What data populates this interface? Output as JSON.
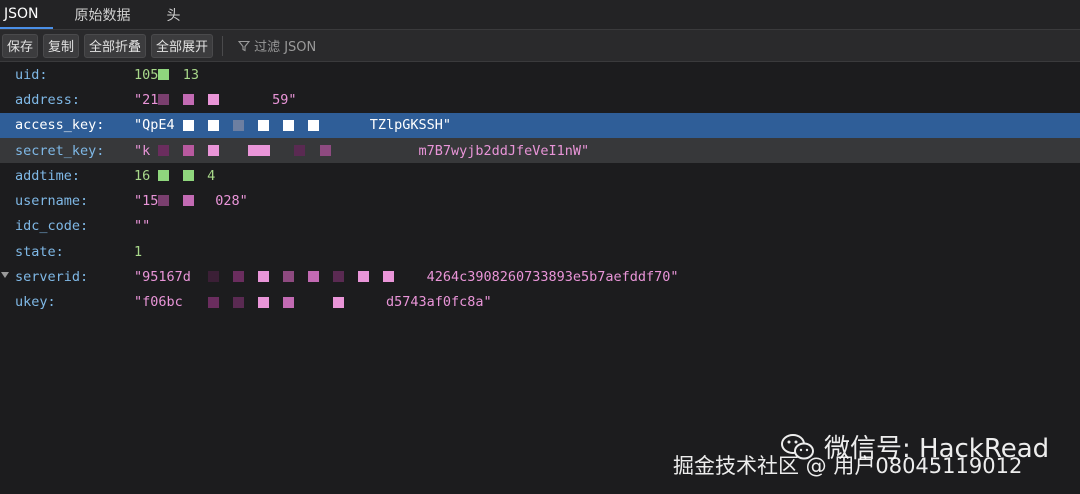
{
  "tabs": [
    {
      "label": "JSON"
    },
    {
      "label": "原始数据"
    },
    {
      "label": "头"
    }
  ],
  "toolbar": {
    "save": "保存",
    "copy": "复制",
    "collapse_all": "全部折叠",
    "expand_all": "全部展开",
    "filter_placeholder": "过滤 JSON"
  },
  "rows": [
    {
      "key": "uid:",
      "value": "105   13"
    },
    {
      "key": "address:",
      "value": "\"21              59\""
    },
    {
      "key": "access_key:",
      "value": "\"QpE4                        TZlpGKSSH\""
    },
    {
      "key": "secret_key:",
      "value": "\"k                                 m7B7wyjb2ddJfeVeI1nW\""
    },
    {
      "key": "addtime:",
      "value": "16       4"
    },
    {
      "key": "username:",
      "value": "\"15       028\""
    },
    {
      "key": "idc_code:",
      "value": "\"\""
    },
    {
      "key": "state:",
      "value": "1"
    },
    {
      "key": "serverid:",
      "value": "\"95167d                             4264c3908260733893e5b7aefddf70\""
    },
    {
      "key": "ukey:",
      "value": "\"f06bc                         d5743af0fc8a\""
    }
  ],
  "watermark": {
    "top": "微信号: HackRead",
    "bottom": "掘金技术社区 @ 用户08045119012"
  }
}
